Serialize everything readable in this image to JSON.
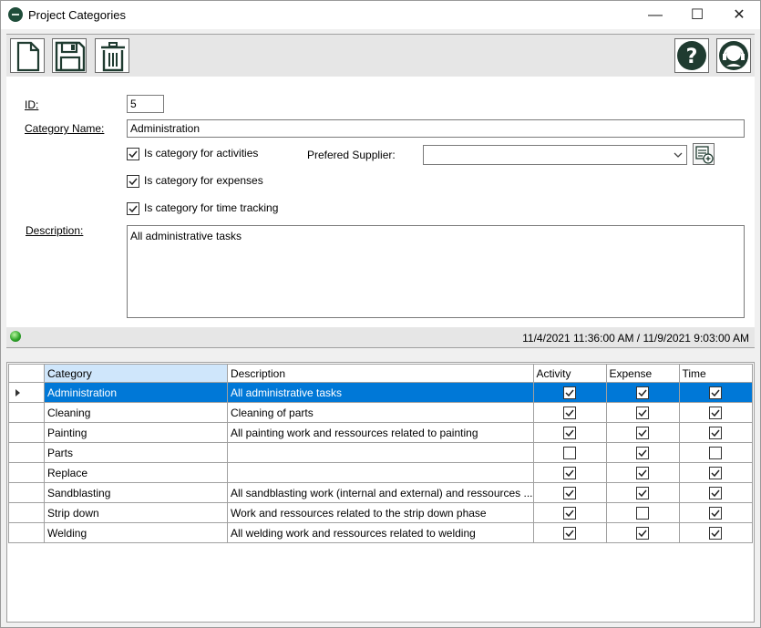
{
  "window": {
    "title": "Project Categories",
    "minimize_glyph": "—",
    "maximize_glyph": "☐",
    "close_glyph": "✕"
  },
  "toolbar": {
    "icons": [
      "new-document-icon",
      "save-icon",
      "delete-icon",
      "help-icon",
      "support-icon"
    ]
  },
  "form": {
    "id_label": "ID:",
    "id_value": "5",
    "name_label": "Category Name:",
    "name_value": "Administration",
    "activities_label": "Is category for activities",
    "activities_checked": true,
    "expenses_label": "Is category for expenses",
    "expenses_checked": true,
    "time_label": "Is category for time tracking",
    "time_checked": true,
    "supplier_label": "Prefered Supplier:",
    "supplier_value": "",
    "description_label": "Description:",
    "description_value": "All administrative tasks"
  },
  "status": {
    "timestamps": "11/4/2021 11:36:00 AM / 11/9/2021 9:03:00 AM",
    "indicator_color": "#2fa52a"
  },
  "grid": {
    "columns": [
      "Category",
      "Description",
      "Activity",
      "Expense",
      "Time"
    ],
    "rows": [
      {
        "category": "Administration",
        "description": "All administrative tasks",
        "activity": true,
        "expense": true,
        "time": true
      },
      {
        "category": "Cleaning",
        "description": "Cleaning of parts",
        "activity": true,
        "expense": true,
        "time": true
      },
      {
        "category": "Painting",
        "description": "All painting work and ressources related to painting",
        "activity": true,
        "expense": true,
        "time": true
      },
      {
        "category": "Parts",
        "description": "",
        "activity": false,
        "expense": true,
        "time": false
      },
      {
        "category": "Replace",
        "description": "",
        "activity": true,
        "expense": true,
        "time": true
      },
      {
        "category": "Sandblasting",
        "description": "All sandblasting work (internal and external) and ressources ...",
        "activity": true,
        "expense": true,
        "time": true
      },
      {
        "category": "Strip down",
        "description": "Work and ressources related to the strip down phase",
        "activity": true,
        "expense": false,
        "time": true
      },
      {
        "category": "Welding",
        "description": "All welding work and ressources related to welding",
        "activity": true,
        "expense": true,
        "time": true
      }
    ]
  },
  "colors": {
    "accent_dark_green": "#1f4d3a",
    "selection_blue": "#0078d7"
  }
}
